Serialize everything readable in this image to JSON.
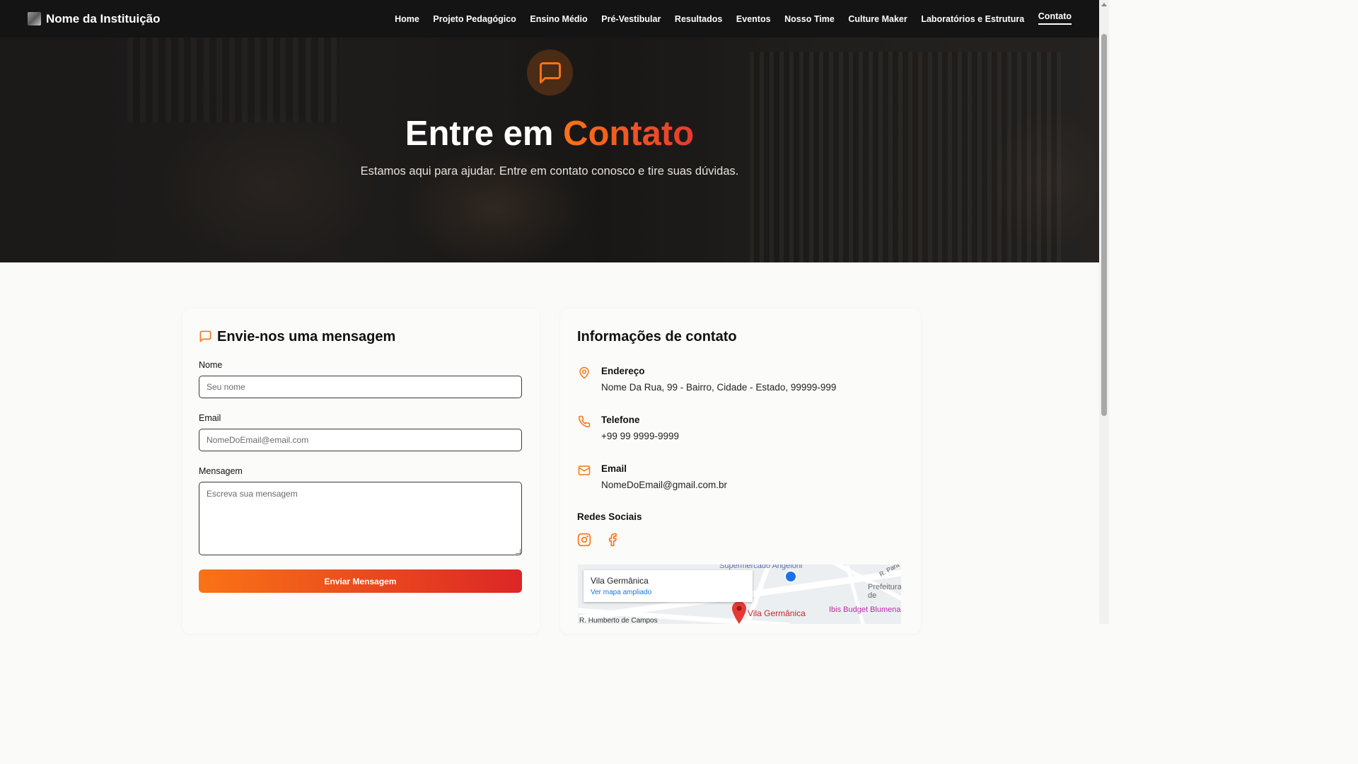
{
  "brand": {
    "name": "Nome da Instituição"
  },
  "nav": {
    "items": [
      {
        "label": "Home",
        "name": "nav-home"
      },
      {
        "label": "Projeto Pedagógico",
        "name": "nav-projeto-pedagogico"
      },
      {
        "label": "Ensino Médio",
        "name": "nav-ensino-medio"
      },
      {
        "label": "Pré-Vestibular",
        "name": "nav-pre-vestibular"
      },
      {
        "label": "Resultados",
        "name": "nav-resultados"
      },
      {
        "label": "Eventos",
        "name": "nav-eventos"
      },
      {
        "label": "Nosso Time",
        "name": "nav-nosso-time"
      },
      {
        "label": "Culture Maker",
        "name": "nav-culture-maker"
      },
      {
        "label": "Laboratórios e Estrutura",
        "name": "nav-laboratorios"
      },
      {
        "label": "Contato",
        "name": "nav-contato",
        "active": true
      }
    ]
  },
  "hero": {
    "title_main": "Entre em",
    "title_accent": "Contato",
    "subtitle": "Estamos aqui para ajudar. Entre em contato conosco e tire suas dúvidas.",
    "icon": "message-square-icon"
  },
  "form": {
    "title": "Envie-nos uma mensagem",
    "name_label": "Nome",
    "name_placeholder": "Seu nome",
    "email_label": "Email",
    "email_placeholder": "NomeDoEmail@email.com",
    "message_label": "Mensagem",
    "message_placeholder": "Escreva sua mensagem",
    "submit_label": "Enviar Mensagem"
  },
  "contact": {
    "title": "Informações de contato",
    "address_label": "Endereço",
    "address_value": "Nome Da Rua, 99 - Bairro, Cidade - Estado, 99999-999",
    "phone_label": "Telefone",
    "phone_value": "+99 99 9999-9999",
    "email_label": "Email",
    "email_value": "NomeDoEmail@gmail.com.br",
    "social_title": "Redes Sociais"
  },
  "map": {
    "place": "Vila Germânica",
    "link": "Ver mapa ampliado",
    "labels": {
      "pin_label": "Vila Germânica",
      "supermarket": "Supermercado Angeloni",
      "prefeitura": "Prefeitura de",
      "hotel": "Ibis Budget Blumena",
      "street": "R. Humberto de Campos",
      "street2": "R. Para"
    }
  },
  "colors": {
    "accent": "#f97316",
    "accent_end": "#dc2626",
    "nav_bg": "#141414"
  }
}
